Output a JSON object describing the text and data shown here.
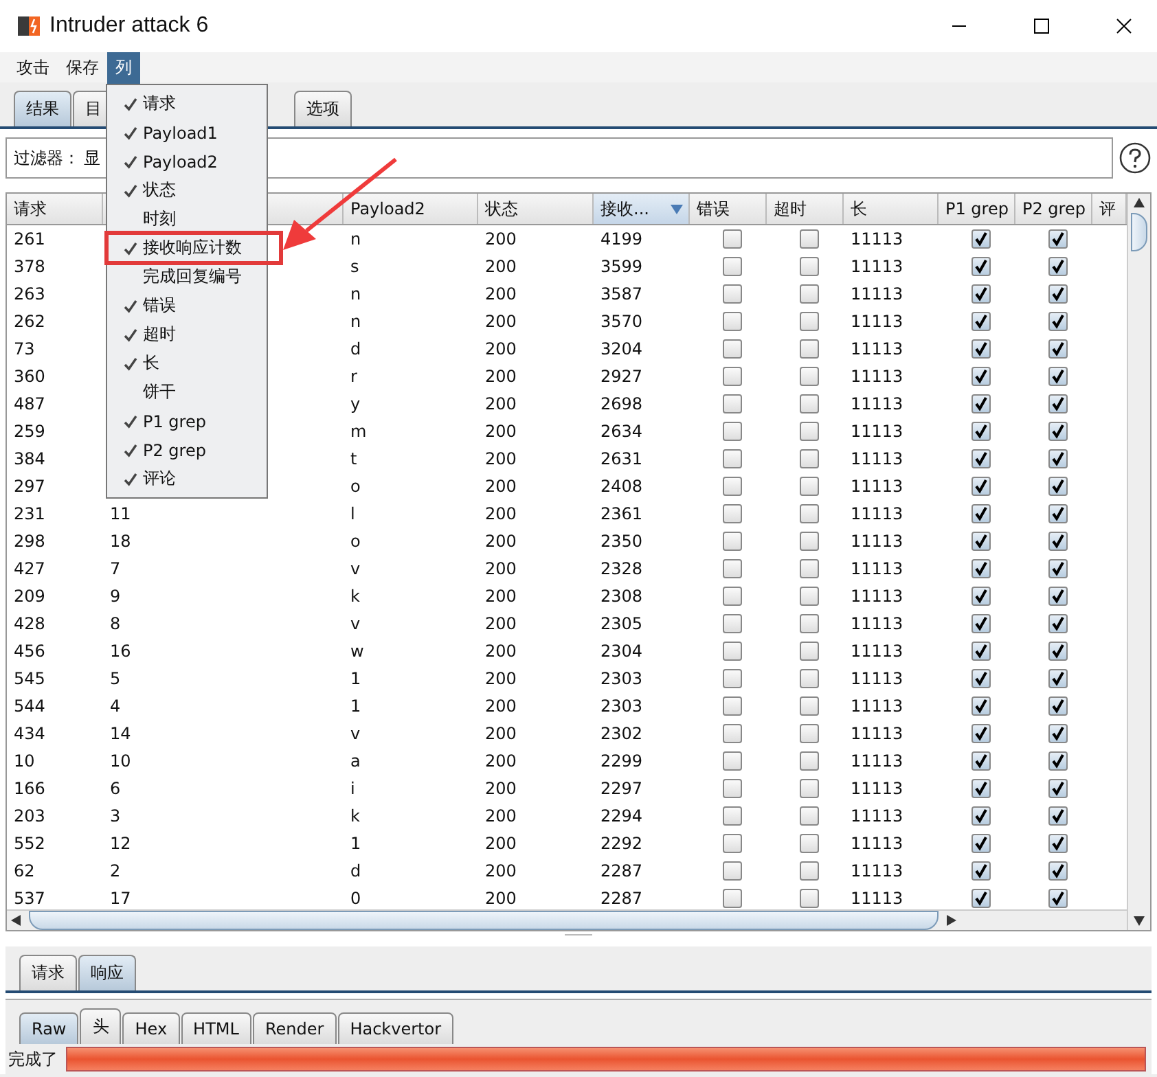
{
  "window": {
    "title": "Intruder attack 6"
  },
  "menu_bar": [
    {
      "label": "攻击",
      "selected": false
    },
    {
      "label": "保存",
      "selected": false
    },
    {
      "label": "列",
      "selected": true
    }
  ],
  "tabs": [
    {
      "label": "结果",
      "selected": true
    },
    {
      "label": "目",
      "selected": false
    },
    {
      "label": "选项",
      "selected": false
    }
  ],
  "filter": {
    "label": "过滤器：",
    "value": "显"
  },
  "table": {
    "columns": [
      {
        "label": "请求",
        "kind": "text"
      },
      {
        "kind": "text"
      },
      {
        "label": "Payload2",
        "kind": "text"
      },
      {
        "label": "状态",
        "kind": "text"
      },
      {
        "label": "接收...",
        "kind": "text",
        "sorted": true
      },
      {
        "label": "错误",
        "kind": "check"
      },
      {
        "label": "超时",
        "kind": "check"
      },
      {
        "label": "长",
        "kind": "text"
      },
      {
        "label": "P1 grep",
        "kind": "check"
      },
      {
        "label": "P2 grep",
        "kind": "check"
      },
      {
        "label": "评",
        "kind": "text"
      }
    ],
    "rows": [
      {
        "cells": [
          "261",
          null,
          "n",
          "200",
          "4199",
          false,
          false,
          "11113",
          true,
          true,
          null
        ]
      },
      {
        "cells": [
          "378",
          null,
          "s",
          "200",
          "3599",
          false,
          false,
          "11113",
          true,
          true,
          null
        ]
      },
      {
        "cells": [
          "263",
          null,
          "n",
          "200",
          "3587",
          false,
          false,
          "11113",
          true,
          true,
          null
        ]
      },
      {
        "cells": [
          "262",
          null,
          "n",
          "200",
          "3570",
          false,
          false,
          "11113",
          true,
          true,
          null
        ]
      },
      {
        "cells": [
          "73",
          null,
          "d",
          "200",
          "3204",
          false,
          false,
          "11113",
          true,
          true,
          null
        ]
      },
      {
        "cells": [
          "360",
          null,
          "r",
          "200",
          "2927",
          false,
          false,
          "11113",
          true,
          true,
          null
        ]
      },
      {
        "cells": [
          "487",
          null,
          "y",
          "200",
          "2698",
          false,
          false,
          "11113",
          true,
          true,
          null
        ]
      },
      {
        "cells": [
          "259",
          null,
          "m",
          "200",
          "2634",
          false,
          false,
          "11113",
          true,
          true,
          null
        ]
      },
      {
        "cells": [
          "384",
          null,
          "t",
          "200",
          "2631",
          false,
          false,
          "11113",
          true,
          true,
          null
        ]
      },
      {
        "cells": [
          "297",
          null,
          "o",
          "200",
          "2408",
          false,
          false,
          "11113",
          true,
          true,
          null
        ]
      },
      {
        "cells": [
          "231",
          "11",
          "l",
          "200",
          "2361",
          false,
          false,
          "11113",
          true,
          true,
          null
        ]
      },
      {
        "cells": [
          "298",
          "18",
          "o",
          "200",
          "2350",
          false,
          false,
          "11113",
          true,
          true,
          null
        ]
      },
      {
        "cells": [
          "427",
          "7",
          "v",
          "200",
          "2328",
          false,
          false,
          "11113",
          true,
          true,
          null
        ]
      },
      {
        "cells": [
          "209",
          "9",
          "k",
          "200",
          "2308",
          false,
          false,
          "11113",
          true,
          true,
          null
        ]
      },
      {
        "cells": [
          "428",
          "8",
          "v",
          "200",
          "2305",
          false,
          false,
          "11113",
          true,
          true,
          null
        ]
      },
      {
        "cells": [
          "456",
          "16",
          "w",
          "200",
          "2304",
          false,
          false,
          "11113",
          true,
          true,
          null
        ]
      },
      {
        "cells": [
          "545",
          "5",
          "1",
          "200",
          "2303",
          false,
          false,
          "11113",
          true,
          true,
          null
        ]
      },
      {
        "cells": [
          "544",
          "4",
          "1",
          "200",
          "2303",
          false,
          false,
          "11113",
          true,
          true,
          null
        ]
      },
      {
        "cells": [
          "434",
          "14",
          "v",
          "200",
          "2302",
          false,
          false,
          "11113",
          true,
          true,
          null
        ]
      },
      {
        "cells": [
          "10",
          "10",
          "a",
          "200",
          "2299",
          false,
          false,
          "11113",
          true,
          true,
          null
        ]
      },
      {
        "cells": [
          "166",
          "6",
          "i",
          "200",
          "2297",
          false,
          false,
          "11113",
          true,
          true,
          null
        ]
      },
      {
        "cells": [
          "203",
          "3",
          "k",
          "200",
          "2294",
          false,
          false,
          "11113",
          true,
          true,
          null
        ]
      },
      {
        "cells": [
          "552",
          "12",
          "1",
          "200",
          "2292",
          false,
          false,
          "11113",
          true,
          true,
          null
        ]
      },
      {
        "cells": [
          "62",
          "2",
          "d",
          "200",
          "2287",
          false,
          false,
          "11113",
          true,
          true,
          null
        ]
      },
      {
        "cells": [
          "537",
          "17",
          "0",
          "200",
          "2287",
          false,
          false,
          "11113",
          true,
          true,
          null
        ]
      }
    ]
  },
  "column_menu": [
    {
      "label": "请求",
      "checked": true,
      "highlighted": false
    },
    {
      "label": "Payload1",
      "checked": true,
      "highlighted": false
    },
    {
      "label": "Payload2",
      "checked": true,
      "highlighted": false
    },
    {
      "label": "状态",
      "checked": true,
      "highlighted": false
    },
    {
      "label": "时刻",
      "checked": false,
      "highlighted": false
    },
    {
      "label": "接收响应计数",
      "checked": true,
      "highlighted": true
    },
    {
      "label": "完成回复编号",
      "checked": false,
      "highlighted": false
    },
    {
      "label": "错误",
      "checked": true,
      "highlighted": false
    },
    {
      "label": "超时",
      "checked": true,
      "highlighted": false
    },
    {
      "label": "长",
      "checked": true,
      "highlighted": false
    },
    {
      "label": "饼干",
      "checked": false,
      "highlighted": false
    },
    {
      "label": "P1 grep",
      "checked": true,
      "highlighted": false
    },
    {
      "label": "P2 grep",
      "checked": true,
      "highlighted": false
    },
    {
      "label": "评论",
      "checked": true,
      "highlighted": false
    }
  ],
  "lower_tabs": [
    {
      "label": "请求",
      "selected": false
    },
    {
      "label": "响应",
      "selected": true
    }
  ],
  "view_tabs": [
    {
      "label": "Raw",
      "selected": true
    },
    {
      "label": "头",
      "selected": false
    },
    {
      "label": "Hex",
      "selected": false
    },
    {
      "label": "HTML",
      "selected": false
    },
    {
      "label": "Render",
      "selected": false
    },
    {
      "label": "Hackvertor",
      "selected": false
    }
  ],
  "status_bar": {
    "text": "完成了",
    "level": 1
  }
}
